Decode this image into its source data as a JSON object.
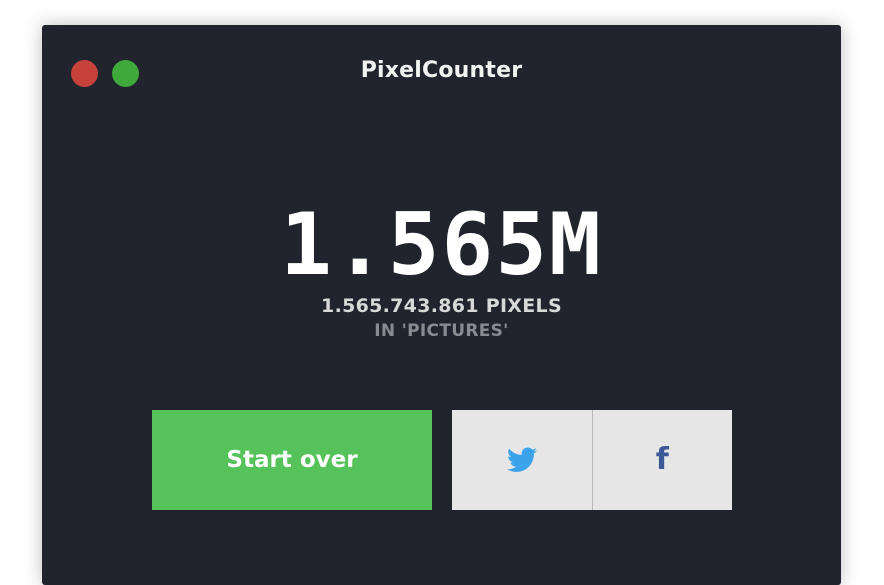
{
  "window": {
    "title": "PixelCounter",
    "controls": [
      "close",
      "zoom"
    ]
  },
  "summary": {
    "short_count": "1.565M",
    "full_count_label": "1.565.743.861 PIXELS",
    "folder_label": "IN 'PICTURES'"
  },
  "actions": {
    "start_over_label": "Start over",
    "share": [
      {
        "icon": "twitter-icon",
        "color": "#3aa3ea"
      },
      {
        "icon": "facebook-icon",
        "glyph": "f",
        "color": "#3b5998"
      }
    ]
  },
  "colors": {
    "window_bg": "#21232d",
    "accent_green": "#55c25a",
    "close_red": "#c6423b",
    "zoom_green": "#3fa93c",
    "share_bg": "#e6e6e6"
  }
}
